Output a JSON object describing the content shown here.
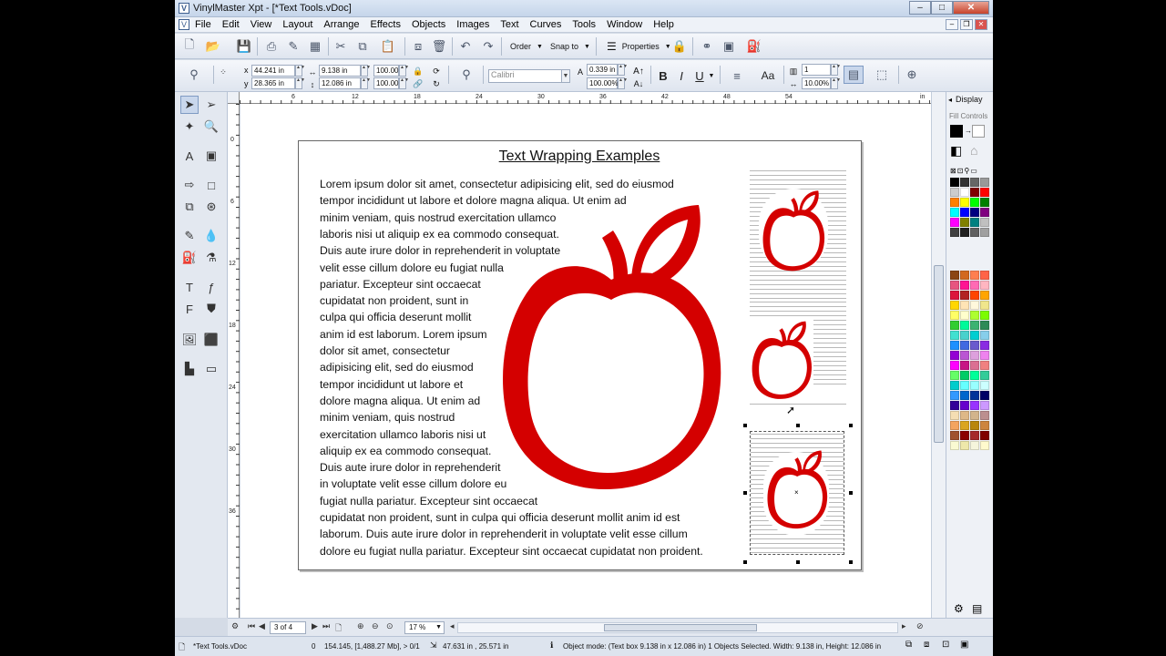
{
  "window": {
    "title": "VinylMaster Xpt - [*Text Tools.vDoc]",
    "app_icon": "V",
    "controls": [
      "–",
      "□",
      "✕"
    ]
  },
  "menu": [
    "File",
    "Edit",
    "View",
    "Layout",
    "Arrange",
    "Effects",
    "Objects",
    "Images",
    "Text",
    "Curves",
    "Tools",
    "Window",
    "Help"
  ],
  "toolbar": {
    "order_label": "Order",
    "snap_label": "Snap to",
    "properties_label": "Properties"
  },
  "props": {
    "x_label": "x",
    "y_label": "y",
    "x_value": "44.241 in",
    "y_value": "28.365 in",
    "width_value": "9.138 in",
    "height_value": "12.086 in",
    "scale_w": "100.00",
    "scale_h": "100.00",
    "font_name": "Calibri",
    "font_size": "0.339 in",
    "font_scale": "100.00%",
    "bold_label": "B",
    "italic_label": "I",
    "underline_label": "U",
    "columns_value": "1",
    "column_gap": "10.00%"
  },
  "ruler": {
    "top_ticks": [
      "0",
      "6",
      "12",
      "18",
      "24",
      "30",
      "36",
      "42",
      "48",
      "54",
      "in"
    ],
    "left_ticks": [
      "0",
      "6",
      "12",
      "18",
      "24",
      "30",
      "36"
    ]
  },
  "document": {
    "title": "Text Wrapping Examples",
    "lines": [
      "Lorem  ipsum  dolor  sit  amet,  consectetur  adipisicing  elit,  sed  do  eiusmod",
      "tempor incididunt ut labore et dolore magna aliqua. Ut enim ad",
      "minim veniam, quis nostrud exercitation ullamco",
      "laboris nisi ut aliquip ex ea commodo consequat.",
      "Duis aute irure dolor in reprehenderit in voluptate",
      "velit esse cillum dolore eu fugiat nulla",
      "pariatur.  Excepteur  sint  occaecat",
      "cupidatat  non  proident,  sunt  in",
      "culpa qui officia deserunt mollit",
      "anim id est laborum. Lorem ipsum",
      "dolor  sit  amet,  consectetur",
      "adipisicing elit, sed do eiusmod",
      "tempor incididunt ut labore et",
      "dolore magna aliqua. Ut enim ad",
      "minim  veniam,  quis  nostrud",
      "exercitation ullamco laboris nisi ut",
      "aliquip ex ea commodo consequat.",
      "Duis aute irure dolor in reprehenderit",
      "in voluptate velit esse cillum dolore eu",
      "fugiat nulla pariatur. Excepteur sint occaecat",
      "cupidatat non proident, sunt in culpa qui officia deserunt mollit anim id est",
      "laborum. Duis aute irure dolor in reprehenderit in voluptate velit esse cillum",
      "dolore eu fugiat nulla pariatur. Excepteur sint occaecat cupidatat non proident."
    ],
    "apple_color": "#d40000"
  },
  "right_panel": {
    "tab": "Display",
    "subtitle": "Fill Controls",
    "palette_basic": [
      "#000000",
      "#333333",
      "#666666",
      "#999999",
      "#cccccc",
      "#ffffff",
      "#800000",
      "#ff0000",
      "#ff8000",
      "#ffff00",
      "#00ff00",
      "#008000",
      "#00ffff",
      "#0000ff",
      "#000080",
      "#800080",
      "#ff00ff",
      "#808000",
      "#008080",
      "#c0c0c0",
      "#404040",
      "#202020",
      "#606060",
      "#a0a0a0"
    ],
    "palette_extended": [
      "#8b4513",
      "#d2691e",
      "#ff7f50",
      "#ff6347",
      "#e75480",
      "#ff1493",
      "#ff69b4",
      "#ffb6c1",
      "#dc143c",
      "#b22222",
      "#ff4500",
      "#ffa500",
      "#ffd700",
      "#ffe4b5",
      "#fff8dc",
      "#f0e68c",
      "#ffff66",
      "#ffffcc",
      "#adff2f",
      "#7cfc00",
      "#32cd32",
      "#00fa9a",
      "#3cb371",
      "#2e8b57",
      "#40e0d0",
      "#48d1cc",
      "#00ced1",
      "#87ceeb",
      "#1e90ff",
      "#4169e1",
      "#6a5acd",
      "#8a2be2",
      "#9400d3",
      "#ba55d3",
      "#dda0dd",
      "#ee82ee",
      "#ff00ff",
      "#c71585",
      "#db7093",
      "#f08080",
      "#66ff66",
      "#00cc66",
      "#00ff99",
      "#33cc99",
      "#00cccc",
      "#66ffff",
      "#99ffff",
      "#ccffff",
      "#3399ff",
      "#0066cc",
      "#003399",
      "#000066",
      "#330099",
      "#6600cc",
      "#9933ff",
      "#cc99ff",
      "#f5deb3",
      "#deb887",
      "#d2b48c",
      "#bc8f8f",
      "#f4a460",
      "#daa520",
      "#b8860b",
      "#cd853f",
      "#a0522d",
      "#8b0000",
      "#a52a2a",
      "#800000",
      "#fafad2",
      "#eee8aa",
      "#f5f5dc",
      "#fffacd"
    ]
  },
  "navigation": {
    "page_indicator": "3 of 4",
    "zoom": "17 %"
  },
  "status": {
    "doc_name": "*Text Tools.vDoc",
    "zero": "0",
    "memory": "154.145, [1,488.27 Mb], > 0/1",
    "cursor": "47.631 in , 25.571 in",
    "mode": "Object mode: (Text box 9.138 in x 12.086 in) 1 Objects Selected.  Width: 9.138 in, Height: 12.086 in"
  }
}
